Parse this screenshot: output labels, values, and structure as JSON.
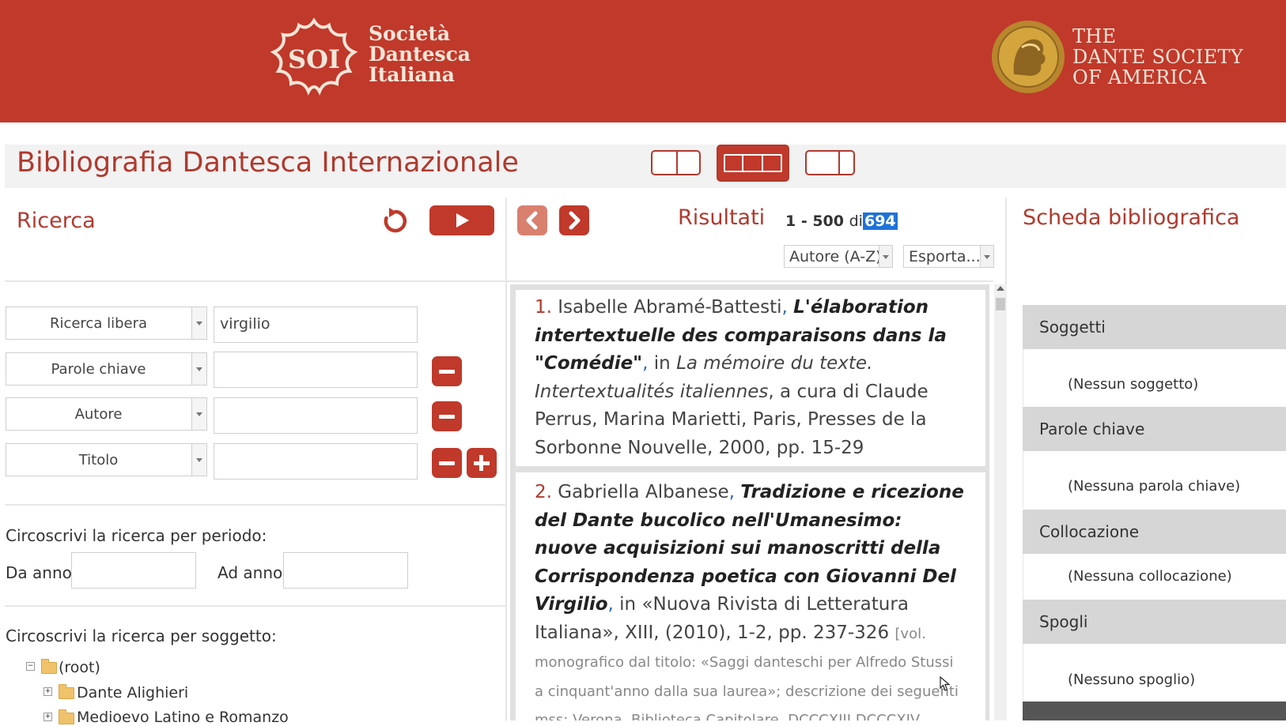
{
  "header": {
    "soi_logo_lines": [
      "Società",
      "Dantesca",
      "Italiana"
    ],
    "dsa_logo_lines": [
      "THE",
      "DANTE SOCIETY",
      "OF AMERICA"
    ],
    "colors": {
      "brand_red": "#c0392b",
      "logo_cream": "#f3e6d8"
    }
  },
  "app": {
    "title": "Bibliografia Dantesca Internazionale",
    "layout_buttons": [
      "two-column-layout",
      "three-column-layout",
      "two-column-right-layout"
    ]
  },
  "search": {
    "heading": "Ricerca",
    "rows": [
      {
        "field": "Ricerca libera",
        "value": "virgilio"
      },
      {
        "field": "Parole chiave",
        "value": ""
      },
      {
        "field": "Autore",
        "value": ""
      },
      {
        "field": "Titolo",
        "value": ""
      }
    ],
    "period_label": "Circoscrivi la ricerca per periodo:",
    "from_label": "Da anno",
    "to_label": "Ad anno",
    "subject_label": "Circoscrivi la ricerca per soggetto:",
    "tree": [
      {
        "toggle": "−",
        "label": "(root)"
      },
      {
        "toggle": "+",
        "label": "Dante Alighieri"
      },
      {
        "toggle": "+",
        "label": "Medioevo Latino e Romanzo"
      }
    ]
  },
  "results": {
    "heading": "Risultati",
    "range": "1 - 500",
    "range_of": "di",
    "total": "694",
    "sort_value": "Autore (A-Z)",
    "export_value": "Esporta...",
    "items": [
      {
        "num": "1.",
        "author": "Isabelle Abramé-Battesti",
        "title": "L'élaboration intertextuelle des comparaisons dans la \"Comédie\"",
        "in": ", in ",
        "source": "La mémoire du texte. Intertextualités italiennes",
        "rest": ", a cura di Claude Perrus, Marina Marietti, Paris, Presses de la Sorbonne Nouvelle, 2000, pp. 15-29"
      },
      {
        "num": "2.",
        "author": "Gabriella Albanese",
        "title": "Tradizione e ricezione del Dante bucolico nell'Umanesimo: nuove acquisizioni sui manoscritti della Corrispondenza poetica con Giovanni Del Virgilio",
        "in": ", in ",
        "source_plain": "«Nuova Rivista di Letteratura Italiana», XIII, (2010), 1-2, pp. 237-326",
        "note": "[vol. monografico dal titolo: «Saggi danteschi per Alfredo Stussi a cinquant'anno dalla sua laurea»; descrizione dei seguenti mss: Verona, Biblioteca Capitolare, DCCCXIII DCCCXIV"
      }
    ]
  },
  "scheda": {
    "heading": "Scheda bibliografica",
    "panels": [
      {
        "title": "Soggetti",
        "empty": "(Nessun soggetto)"
      },
      {
        "title": "Parole chiave",
        "empty": "(Nessuna parola chiave)"
      },
      {
        "title": "Collocazione",
        "empty": "(Nessuna collocazione)"
      },
      {
        "title": "Spogli",
        "empty": "(Nessuno spoglio)"
      }
    ]
  }
}
